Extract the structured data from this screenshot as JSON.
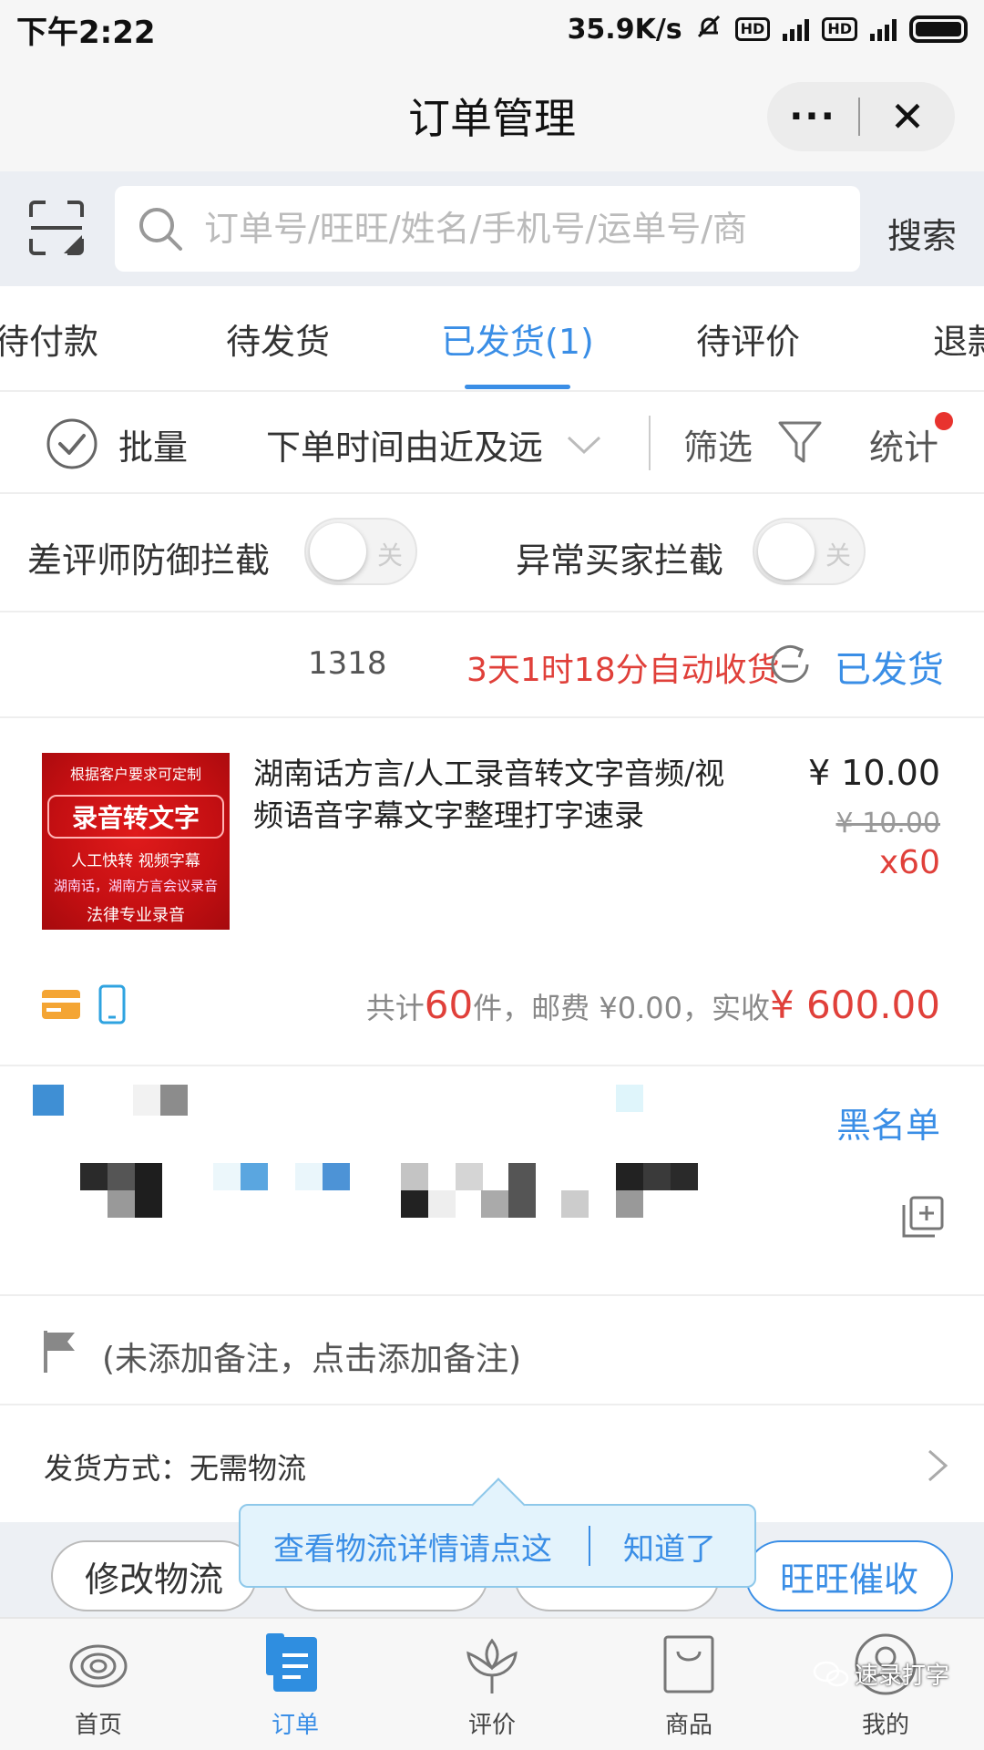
{
  "status_bar": {
    "time": "下午2:22",
    "net_speed": "35.9K/s",
    "hd": "HD",
    "net_type": "4G"
  },
  "header": {
    "title": "订单管理",
    "more": "···",
    "close": "✕"
  },
  "search": {
    "placeholder": "订单号/旺旺/姓名/手机号/运单号/商",
    "button": "搜索"
  },
  "tabs": [
    {
      "label": "待付款",
      "active": false
    },
    {
      "label": "待发货",
      "active": false
    },
    {
      "label": "已发货(1)",
      "active": true
    },
    {
      "label": "待评价",
      "active": false
    },
    {
      "label": "退款",
      "active": false
    }
  ],
  "filter_bar": {
    "batch": "批量",
    "sort": "下单时间由近及远",
    "filter": "筛选",
    "stats": "统计"
  },
  "toggles": [
    {
      "label": "差评师防御拦截",
      "state": "关"
    },
    {
      "label": "异常买家拦截",
      "state": "关"
    }
  ],
  "order": {
    "id_fragment": "1318",
    "auto_receive": "3天1时18分自动收货",
    "status": "已发货",
    "product": {
      "image_lines": [
        "根据客户要求可定制",
        "录音转文字",
        "人工快转 视频字幕",
        "湖南话，湖南方言会议录音",
        "法律专业录音"
      ],
      "title": "湖南话方言/人工录音转文字音频/视频语音字幕文字整理打字速录",
      "price": "¥ 10.00",
      "original_price": "¥ 10.00",
      "quantity": "x60"
    },
    "total": {
      "prefix": "共计",
      "count": "60",
      "middle": "件，邮费 ¥0.00，实收",
      "amount": "¥ 600.00"
    },
    "blacklist": "黑名单",
    "remark": "(未添加备注，点击添加备注)",
    "delivery": "发货方式：无需物流"
  },
  "actions": {
    "modify_logistics": "修改物流",
    "wangwang_remind": "旺旺催收"
  },
  "tooltip": {
    "text": "查看物流详情请点这",
    "ok": "知道了"
  },
  "bottom_nav": [
    {
      "label": "首页",
      "icon": "home-icon",
      "active": false
    },
    {
      "label": "订单",
      "icon": "order-icon",
      "active": true
    },
    {
      "label": "评价",
      "icon": "review-icon",
      "active": false
    },
    {
      "label": "商品",
      "icon": "goods-icon",
      "active": false
    },
    {
      "label": "我的",
      "icon": "profile-icon",
      "active": false
    }
  ],
  "watermark": "速录打字",
  "colors": {
    "accent": "#3a8ee6",
    "alert": "#e0403a"
  }
}
